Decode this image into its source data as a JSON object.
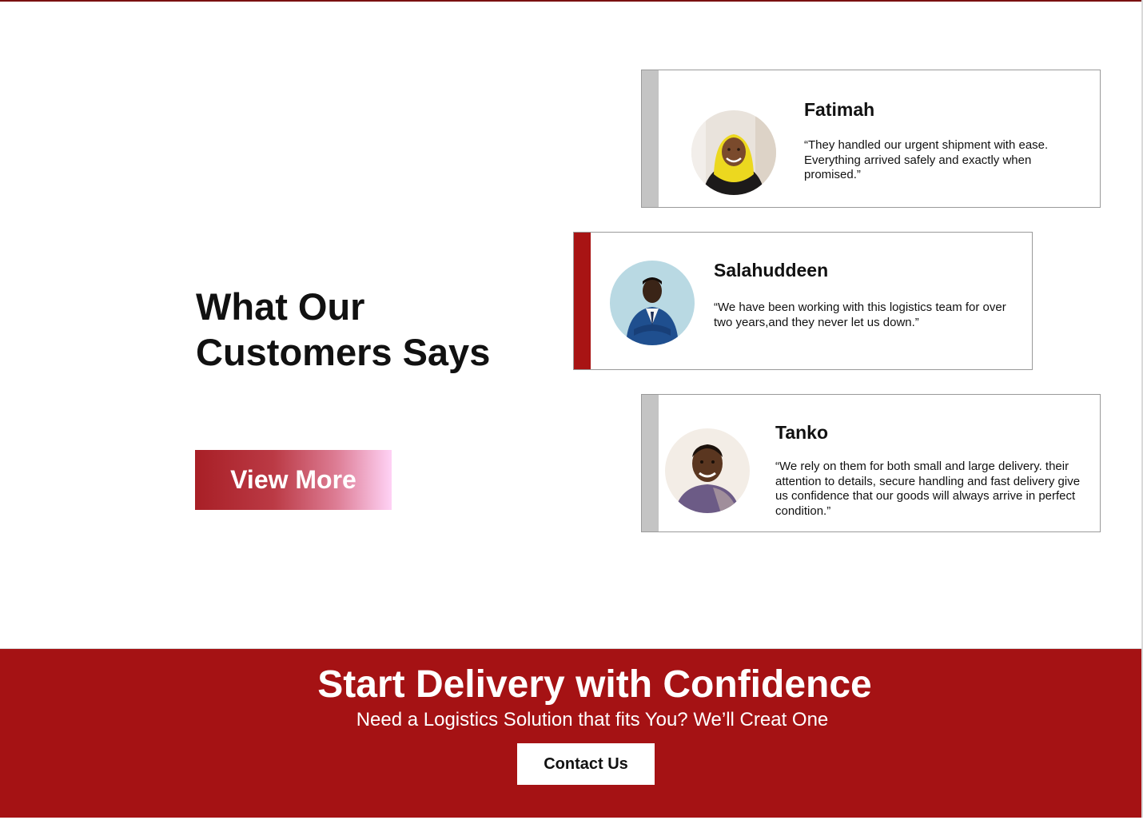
{
  "testimonials": {
    "heading": "What Our Customers Says",
    "view_more_label": "View More",
    "items": [
      {
        "name": "Fatimah",
        "quote": "“They handled our urgent shipment with ease. Everything arrived safely and exactly when promised.”",
        "accent": "#c4c4c4"
      },
      {
        "name": "Salahuddeen",
        "quote": "“We have been working with this logistics team for over two years,and they never let us down.”",
        "accent": "#a81414"
      },
      {
        "name": "Tanko",
        "quote": "“We rely on them for both small and large delivery. their attention to details, secure handling and fast delivery give us confidence that our goods will always arrive in perfect condition.”",
        "accent": "#c4c4c4"
      }
    ]
  },
  "cta": {
    "title": "Start Delivery with Confidence",
    "subtitle": "Need a Logistics Solution that fits You? We’ll Creat One",
    "button_label": "Contact Us",
    "background": "#a51214"
  },
  "icons": {
    "avatar_1": "avatar-woman-yellow-hijab",
    "avatar_2": "avatar-man-blue-suit",
    "avatar_3": "avatar-man-smiling"
  },
  "colors": {
    "brand_red": "#a51214",
    "gradient_end": "#ffd2f5"
  }
}
